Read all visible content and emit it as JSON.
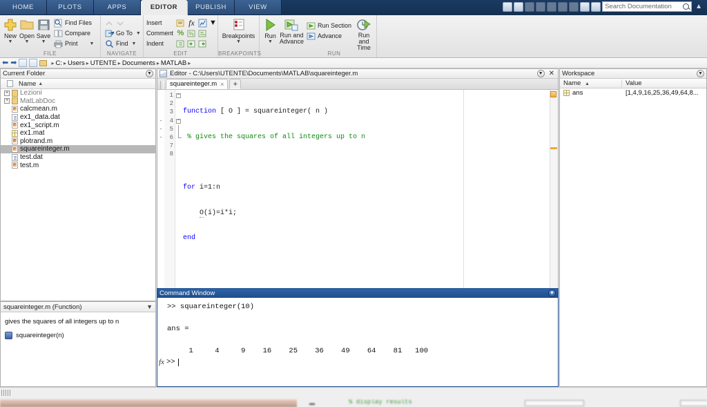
{
  "ribbon": {
    "tabs": [
      {
        "label": "HOME",
        "active": false
      },
      {
        "label": "PLOTS",
        "active": false
      },
      {
        "label": "APPS",
        "active": false
      },
      {
        "label": "EDITOR",
        "active": true
      },
      {
        "label": "PUBLISH",
        "active": false
      },
      {
        "label": "VIEW",
        "active": false
      }
    ],
    "search_placeholder": "Search Documentation",
    "groups": [
      {
        "label": "FILE",
        "big": [
          {
            "label": "New",
            "icon": "new-plus-icon",
            "caret": "▼"
          },
          {
            "label": "Open",
            "icon": "open-folder-icon",
            "caret": "▼"
          },
          {
            "label": "Save",
            "icon": "save-disk-icon",
            "caret": "▼"
          }
        ],
        "small": [
          {
            "label": "Find Files",
            "icon": "find-files-icon",
            "caret": ""
          },
          {
            "label": "Compare",
            "icon": "compare-icon",
            "caret": "▼"
          },
          {
            "label": "Print",
            "icon": "print-icon",
            "caret": "▼"
          }
        ]
      },
      {
        "label": "NAVIGATE",
        "small": [
          {
            "label": "",
            "icon": "nav-back-icon",
            "caret": "",
            "dim": true
          },
          {
            "label": "Go To",
            "icon": "go-to-icon",
            "caret": "▼"
          },
          {
            "label": "Find",
            "icon": "find-magnifier-icon",
            "caret": "▼"
          }
        ]
      },
      {
        "label": "EDIT",
        "rows": [
          {
            "label": "Insert",
            "icons": [
              "insert-block-icon",
              "insert-function-icon",
              "insert-plot-icon"
            ],
            "caret": "▼"
          },
          {
            "label": "Comment",
            "icons": [
              "comment-percent-icon",
              "uncomment-icon",
              "wrap-comment-icon"
            ],
            "caret": ""
          },
          {
            "label": "Indent",
            "icons": [
              "smart-indent-icon",
              "indent-right-icon",
              "indent-left-icon"
            ],
            "caret": ""
          }
        ]
      },
      {
        "label": "BREAKPOINTS",
        "big": [
          {
            "label": "Breakpoints",
            "icon": "breakpoints-icon",
            "caret": "▼"
          }
        ]
      },
      {
        "label": "RUN",
        "big": [
          {
            "label": "Run",
            "icon": "run-play-icon",
            "caret": "▼"
          },
          {
            "label": "Run and Advance",
            "icon": "run-and-advance-icon",
            "caret": ""
          },
          {
            "label": "Run and Time",
            "icon": "run-and-time-icon",
            "caret": ""
          }
        ],
        "small": [
          {
            "label": "Run Section",
            "icon": "run-section-icon",
            "caret": ""
          },
          {
            "label": "Advance",
            "icon": "advance-icon",
            "caret": ""
          }
        ]
      }
    ]
  },
  "addressbar": {
    "crumbs": [
      "C:",
      "Users",
      "UTENTE",
      "Documents",
      "MATLAB"
    ],
    "separator": "▸"
  },
  "current_folder": {
    "title": "Current Folder",
    "column_header": "Name",
    "sort_arrow": "▲",
    "files": [
      {
        "name": "Lezioni",
        "type": "folder",
        "expandable": true,
        "selected": false
      },
      {
        "name": "MatLabDoc",
        "type": "folder",
        "expandable": true,
        "selected": false
      },
      {
        "name": "calcmean.m",
        "type": "m",
        "expandable": false,
        "selected": false
      },
      {
        "name": "ex1_data.dat",
        "type": "dat",
        "expandable": false,
        "selected": false
      },
      {
        "name": "ex1_script.m",
        "type": "m",
        "expandable": false,
        "selected": false
      },
      {
        "name": "ex1.mat",
        "type": "mat",
        "expandable": false,
        "selected": false
      },
      {
        "name": "plotrand.m",
        "type": "m",
        "expandable": false,
        "selected": false
      },
      {
        "name": "squareinteger.m",
        "type": "m",
        "expandable": false,
        "selected": true
      },
      {
        "name": "test.dat",
        "type": "dat",
        "expandable": false,
        "selected": false
      },
      {
        "name": "test.m",
        "type": "m",
        "expandable": false,
        "selected": false
      }
    ]
  },
  "details": {
    "title": "squareinteger.m  (Function)",
    "description": "gives the squares of all integers up to n",
    "signature": "squareinteger(n)"
  },
  "editor": {
    "title": "Editor - C:\\Users\\UTENTE\\Documents\\MATLAB\\squareinteger.m",
    "tab_label": "squareinteger.m",
    "tab_close": "×",
    "new_tab": "+",
    "lines": [
      {
        "num": "1",
        "bp": "",
        "fold": "minus",
        "html": "<span class=\"kw\">function</span> [ O ] = squareinteger( n )"
      },
      {
        "num": "2",
        "bp": "",
        "fold": "",
        "html": "<span class=\"cm\"> % gives the squares of all integers up to n</span>"
      },
      {
        "num": "3",
        "bp": "",
        "fold": "",
        "html": ""
      },
      {
        "num": "4",
        "bp": "-",
        "fold": "minus",
        "html": "<span class=\"kw\">for</span> i=1:n"
      },
      {
        "num": "5",
        "bp": "-",
        "fold": "",
        "html": "    <span class=\"und\">O</span>(i)=i*i;"
      },
      {
        "num": "6",
        "bp": "-",
        "fold": "end",
        "html": "<span class=\"kw\">end</span>"
      },
      {
        "num": "7",
        "bp": "",
        "fold": "",
        "html": ""
      },
      {
        "num": "8",
        "bp": "",
        "fold": "",
        "html": ""
      }
    ]
  },
  "command_window": {
    "title": "Command Window",
    "lines": [
      ">> squareinteger(10)",
      "",
      "ans =",
      "",
      "     1     4     9    16    25    36    49    64    81   100"
    ],
    "prompt": ">>",
    "fx_label": "fx"
  },
  "workspace": {
    "title": "Workspace",
    "columns": [
      "Name",
      "Value"
    ],
    "sort_arrow": "▲",
    "rows": [
      {
        "name": "ans",
        "value": "[1,4,9,16,25,36,49,64,8..."
      }
    ]
  },
  "background": {
    "text": "% display results"
  },
  "colors": {
    "ribbon_tab_bg": "#2b4c77",
    "ribbon_tab_active": "#ececec",
    "cmdwin_title": "#1e4d8c",
    "keyword": "#0b00ff",
    "comment": "#0f8a0f",
    "selection": "#b8b8b8",
    "warning": "#f0a93c"
  }
}
